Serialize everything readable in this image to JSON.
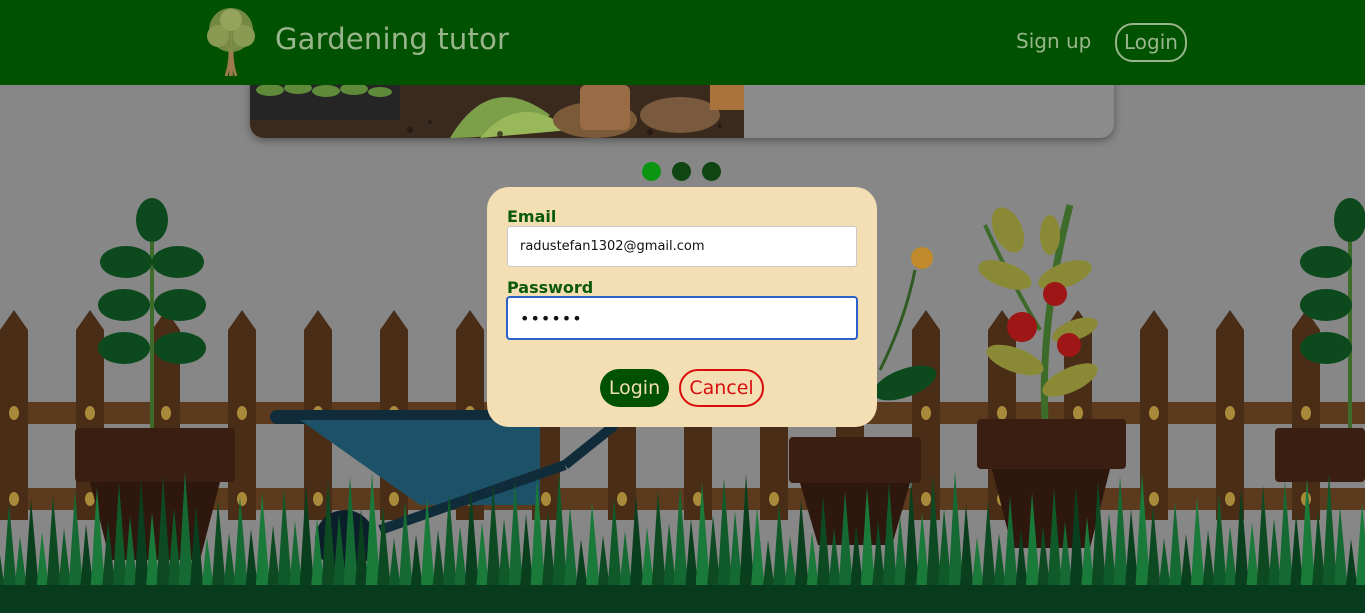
{
  "header": {
    "brand": "Gardening tutor",
    "nav": {
      "signup_label": "Sign up",
      "login_label": "Login"
    }
  },
  "carousel": {
    "slide_count": 3,
    "active_index": 0
  },
  "login_modal": {
    "email_label": "Email",
    "email_value": "radustefan1302@gmail.com",
    "password_label": "Password",
    "password_value": "••••••",
    "login_label": "Login",
    "cancel_label": "Cancel"
  },
  "colors": {
    "header_bg": "#005200",
    "header_text": "#99b58c",
    "modal_bg": "#f4deb4",
    "label_green": "#0a5a0a",
    "cancel_red": "#d80e0e",
    "dot_active": "#0a9610",
    "dot_inactive": "#0f4512"
  }
}
